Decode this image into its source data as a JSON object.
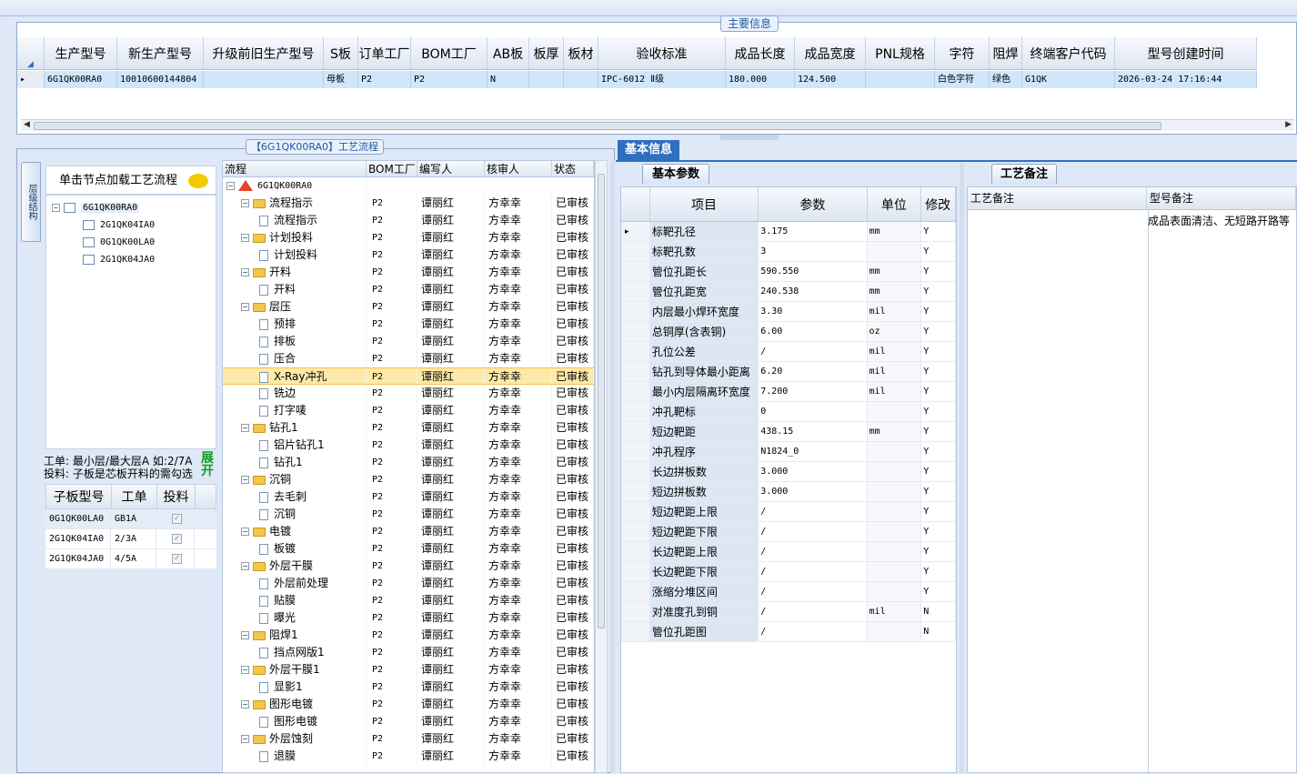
{
  "main_info": {
    "title": "主要信息",
    "columns": [
      "生产型号",
      "新生产型号",
      "升级前旧生产型号",
      "S板",
      "订单工厂",
      "BOM工厂",
      "AB板",
      "板厚",
      "板材",
      "验收标准",
      "成品长度",
      "成品宽度",
      "PNL规格",
      "字符",
      "阻焊",
      "终端客户代码",
      "型号创建时间"
    ],
    "row": [
      "6G1QK00RA0",
      "10010600144804",
      "",
      "母板",
      "P2",
      "P2",
      "N",
      "",
      "",
      "IPC-6012 Ⅱ级",
      "180.000",
      "124.500",
      "",
      "白色字符",
      "绿色",
      "G1QK",
      "2026-03-24 17:16:44"
    ]
  },
  "flow": {
    "title": "【6G1QK00RA0】工艺流程",
    "side_tab": "层级结构",
    "load_hint": "单击节点加载工艺流程",
    "tree": {
      "root": "6G1QK00RA0",
      "children": [
        "2G1QK04IA0",
        "0G1QK00LA0",
        "2G1QK04JA0"
      ]
    },
    "note_line1": "工单: 最小层/最大层A 如:2/7A",
    "note_line2": "投料: 子板是芯板开料的需勾选",
    "expand_label": "展开",
    "sub_table": {
      "headers": [
        "子板型号",
        "工单",
        "投料"
      ],
      "rows": [
        {
          "model": "0G1QK00LA0",
          "order": "GB1A"
        },
        {
          "model": "2G1QK04IA0",
          "order": "2/3A"
        },
        {
          "model": "2G1QK04JA0",
          "order": "4/5A"
        }
      ]
    },
    "grid_headers": [
      "流程",
      "BOM工厂",
      "编写人",
      "核审人",
      "状态"
    ],
    "root_node": "6G1QK00RA0",
    "rows": [
      {
        "name": "流程指示",
        "level": 1,
        "type": "folder",
        "bom": "P2",
        "writer": "谭丽红",
        "reviewer": "方幸幸",
        "status": "已审核"
      },
      {
        "name": "流程指示",
        "level": 2,
        "type": "doc",
        "bom": "P2",
        "writer": "谭丽红",
        "reviewer": "方幸幸",
        "status": "已审核"
      },
      {
        "name": "计划投料",
        "level": 1,
        "type": "folder",
        "bom": "P2",
        "writer": "谭丽红",
        "reviewer": "方幸幸",
        "status": "已审核"
      },
      {
        "name": "计划投料",
        "level": 2,
        "type": "doc",
        "bom": "P2",
        "writer": "谭丽红",
        "reviewer": "方幸幸",
        "status": "已审核"
      },
      {
        "name": "开料",
        "level": 1,
        "type": "folder",
        "bom": "P2",
        "writer": "谭丽红",
        "reviewer": "方幸幸",
        "status": "已审核"
      },
      {
        "name": "开料",
        "level": 2,
        "type": "doc",
        "bom": "P2",
        "writer": "谭丽红",
        "reviewer": "方幸幸",
        "status": "已审核"
      },
      {
        "name": "层压",
        "level": 1,
        "type": "folder",
        "bom": "P2",
        "writer": "谭丽红",
        "reviewer": "方幸幸",
        "status": "已审核"
      },
      {
        "name": "预排",
        "level": 2,
        "type": "doc",
        "bom": "P2",
        "writer": "谭丽红",
        "reviewer": "方幸幸",
        "status": "已审核"
      },
      {
        "name": "排板",
        "level": 2,
        "type": "doc",
        "bom": "P2",
        "writer": "谭丽红",
        "reviewer": "方幸幸",
        "status": "已审核"
      },
      {
        "name": "压合",
        "level": 2,
        "type": "doc",
        "bom": "P2",
        "writer": "谭丽红",
        "reviewer": "方幸幸",
        "status": "已审核"
      },
      {
        "name": "X-Ray冲孔",
        "level": 2,
        "type": "doc",
        "bom": "P2",
        "writer": "谭丽红",
        "reviewer": "方幸幸",
        "status": "已审核",
        "selected": true
      },
      {
        "name": "铣边",
        "level": 2,
        "type": "doc",
        "bom": "P2",
        "writer": "谭丽红",
        "reviewer": "方幸幸",
        "status": "已审核"
      },
      {
        "name": "打字唛",
        "level": 2,
        "type": "doc",
        "bom": "P2",
        "writer": "谭丽红",
        "reviewer": "方幸幸",
        "status": "已审核"
      },
      {
        "name": "钻孔1",
        "level": 1,
        "type": "folder",
        "bom": "P2",
        "writer": "谭丽红",
        "reviewer": "方幸幸",
        "status": "已审核"
      },
      {
        "name": "铝片钻孔1",
        "level": 2,
        "type": "doc",
        "bom": "P2",
        "writer": "谭丽红",
        "reviewer": "方幸幸",
        "status": "已审核"
      },
      {
        "name": "钻孔1",
        "level": 2,
        "type": "doc",
        "bom": "P2",
        "writer": "谭丽红",
        "reviewer": "方幸幸",
        "status": "已审核"
      },
      {
        "name": "沉铜",
        "level": 1,
        "type": "folder",
        "bom": "P2",
        "writer": "谭丽红",
        "reviewer": "方幸幸",
        "status": "已审核"
      },
      {
        "name": "去毛刺",
        "level": 2,
        "type": "doc",
        "bom": "P2",
        "writer": "谭丽红",
        "reviewer": "方幸幸",
        "status": "已审核"
      },
      {
        "name": "沉铜",
        "level": 2,
        "type": "doc",
        "bom": "P2",
        "writer": "谭丽红",
        "reviewer": "方幸幸",
        "status": "已审核"
      },
      {
        "name": "电镀",
        "level": 1,
        "type": "folder",
        "bom": "P2",
        "writer": "谭丽红",
        "reviewer": "方幸幸",
        "status": "已审核"
      },
      {
        "name": "板镀",
        "level": 2,
        "type": "doc",
        "bom": "P2",
        "writer": "谭丽红",
        "reviewer": "方幸幸",
        "status": "已审核"
      },
      {
        "name": "外层干膜",
        "level": 1,
        "type": "folder",
        "bom": "P2",
        "writer": "谭丽红",
        "reviewer": "方幸幸",
        "status": "已审核"
      },
      {
        "name": "外层前处理",
        "level": 2,
        "type": "doc",
        "bom": "P2",
        "writer": "谭丽红",
        "reviewer": "方幸幸",
        "status": "已审核"
      },
      {
        "name": "贴膜",
        "level": 2,
        "type": "doc",
        "bom": "P2",
        "writer": "谭丽红",
        "reviewer": "方幸幸",
        "status": "已审核"
      },
      {
        "name": "曝光",
        "level": 2,
        "type": "doc",
        "bom": "P2",
        "writer": "谭丽红",
        "reviewer": "方幸幸",
        "status": "已审核"
      },
      {
        "name": "阻焊1",
        "level": 1,
        "type": "folder",
        "bom": "P2",
        "writer": "谭丽红",
        "reviewer": "方幸幸",
        "status": "已审核"
      },
      {
        "name": "挡点网版1",
        "level": 2,
        "type": "doc",
        "bom": "P2",
        "writer": "谭丽红",
        "reviewer": "方幸幸",
        "status": "已审核"
      },
      {
        "name": "外层干膜1",
        "level": 1,
        "type": "folder",
        "bom": "P2",
        "writer": "谭丽红",
        "reviewer": "方幸幸",
        "status": "已审核"
      },
      {
        "name": "显影1",
        "level": 2,
        "type": "doc",
        "bom": "P2",
        "writer": "谭丽红",
        "reviewer": "方幸幸",
        "status": "已审核"
      },
      {
        "name": "图形电镀",
        "level": 1,
        "type": "folder",
        "bom": "P2",
        "writer": "谭丽红",
        "reviewer": "方幸幸",
        "status": "已审核"
      },
      {
        "name": "图形电镀",
        "level": 2,
        "type": "doc",
        "bom": "P2",
        "writer": "谭丽红",
        "reviewer": "方幸幸",
        "status": "已审核"
      },
      {
        "name": "外层蚀刻",
        "level": 1,
        "type": "folder",
        "bom": "P2",
        "writer": "谭丽红",
        "reviewer": "方幸幸",
        "status": "已审核"
      },
      {
        "name": "退膜",
        "level": 2,
        "type": "doc",
        "bom": "P2",
        "writer": "谭丽红",
        "reviewer": "方幸幸",
        "status": "已审核"
      }
    ]
  },
  "basic_info": {
    "tab_label": "基本信息",
    "param_tab": "基本参数",
    "headers": [
      "项目",
      "参数",
      "单位",
      "修改"
    ],
    "params": [
      {
        "item": "标靶孔径",
        "value": "3.175",
        "unit": "mm",
        "mod": "Y"
      },
      {
        "item": "标靶孔数",
        "value": "3",
        "unit": "",
        "mod": "Y"
      },
      {
        "item": "管位孔距长",
        "value": "590.550",
        "unit": "mm",
        "mod": "Y"
      },
      {
        "item": "管位孔距宽",
        "value": "240.538",
        "unit": "mm",
        "mod": "Y"
      },
      {
        "item": "内层最小焊环宽度",
        "value": "3.30",
        "unit": "mil",
        "mod": "Y"
      },
      {
        "item": "总铜厚(含表铜)",
        "value": "6.00",
        "unit": "oz",
        "mod": "Y"
      },
      {
        "item": "孔位公差",
        "value": "/",
        "unit": "mil",
        "mod": "Y"
      },
      {
        "item": "钻孔到导体最小距离",
        "value": "6.20",
        "unit": "mil",
        "mod": "Y"
      },
      {
        "item": "最小内层隔离环宽度",
        "value": "7.200",
        "unit": "mil",
        "mod": "Y"
      },
      {
        "item": "冲孔靶标",
        "value": "0",
        "unit": "",
        "mod": "Y"
      },
      {
        "item": "短边靶距",
        "value": "438.15",
        "unit": "mm",
        "mod": "Y"
      },
      {
        "item": "冲孔程序",
        "value": "N1824_0",
        "unit": "",
        "mod": "Y"
      },
      {
        "item": "长边拼板数",
        "value": "3.000",
        "unit": "",
        "mod": "Y"
      },
      {
        "item": "短边拼板数",
        "value": "3.000",
        "unit": "",
        "mod": "Y"
      },
      {
        "item": "短边靶距上限",
        "value": "/",
        "unit": "",
        "mod": "Y"
      },
      {
        "item": "短边靶距下限",
        "value": "/",
        "unit": "",
        "mod": "Y"
      },
      {
        "item": "长边靶距上限",
        "value": "/",
        "unit": "",
        "mod": "Y"
      },
      {
        "item": "长边靶距下限",
        "value": "/",
        "unit": "",
        "mod": "Y"
      },
      {
        "item": "涨缩分堆区间",
        "value": "/",
        "unit": "",
        "mod": "Y"
      },
      {
        "item": "对准度孔到铜",
        "value": "/",
        "unit": "mil",
        "mod": "N"
      },
      {
        "item": "管位孔距图",
        "value": "/",
        "unit": "",
        "mod": "N"
      }
    ]
  },
  "process_note": {
    "tab_label": "工艺备注",
    "col1": "工艺备注",
    "col2": "型号备注",
    "model_note": "成品表面清洁、无短路开路等"
  }
}
